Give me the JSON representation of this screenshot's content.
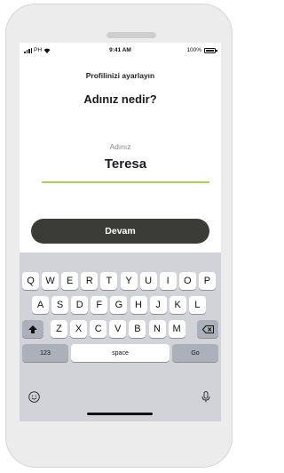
{
  "status_bar": {
    "carrier": "PH",
    "time": "9:41 AM",
    "battery": "100%"
  },
  "screen": {
    "subtitle": "Profilinizi ayarlayın",
    "title": "Adınız nedir?",
    "field_label": "Adınız",
    "field_value": "Teresa",
    "continue_label": "Devam"
  },
  "keyboard": {
    "row1": [
      "Q",
      "W",
      "E",
      "R",
      "T",
      "Y",
      "U",
      "I",
      "O",
      "P"
    ],
    "row2": [
      "A",
      "S",
      "D",
      "F",
      "G",
      "H",
      "J",
      "K",
      "L"
    ],
    "row3": [
      "Z",
      "X",
      "C",
      "V",
      "B",
      "N",
      "M"
    ],
    "numbers_label": "123",
    "space_label": "space",
    "go_label": "Go"
  },
  "icons": {
    "shift": "shift-icon",
    "backspace": "backspace-icon",
    "emoji": "emoji-icon",
    "microphone": "microphone-icon"
  },
  "colors": {
    "accent_line": "#a8cf5a",
    "button": "#3b3b37"
  }
}
